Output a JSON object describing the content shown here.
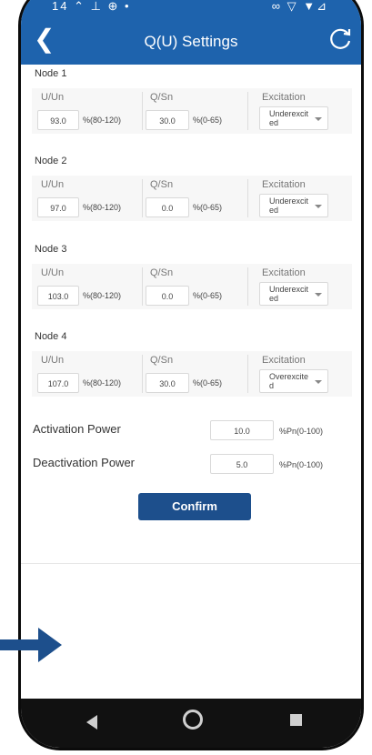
{
  "status_bar": {
    "left_icons": "14 ⌃ ⊥ ⊕ •",
    "right_icons": "∞ ▽ ▼⊿"
  },
  "header": {
    "title": "Q(U) Settings",
    "back_icon": "back-arrow-icon",
    "refresh_icon": "refresh-icon"
  },
  "nodes": [
    {
      "title": "Node 1",
      "u_label": "U/Un",
      "u_value": "93.0",
      "u_unit": "%(80-120)",
      "q_label": "Q/Sn",
      "q_value": "30.0",
      "q_unit": "%(0-65)",
      "ex_label": "Excitation",
      "ex_value": "Underexcited"
    },
    {
      "title": "Node 2",
      "u_label": "U/Un",
      "u_value": "97.0",
      "u_unit": "%(80-120)",
      "q_label": "Q/Sn",
      "q_value": "0.0",
      "q_unit": "%(0-65)",
      "ex_label": "Excitation",
      "ex_value": "Underexcited"
    },
    {
      "title": "Node 3",
      "u_label": "U/Un",
      "u_value": "103.0",
      "u_unit": "%(80-120)",
      "q_label": "Q/Sn",
      "q_value": "0.0",
      "q_unit": "%(0-65)",
      "ex_label": "Excitation",
      "ex_value": "Underexcited"
    },
    {
      "title": "Node 4",
      "u_label": "U/Un",
      "u_value": "107.0",
      "u_unit": "%(80-120)",
      "q_label": "Q/Sn",
      "q_value": "30.0",
      "q_unit": "%(0-65)",
      "ex_label": "Excitation",
      "ex_value": "Overexcited"
    }
  ],
  "activation": {
    "label": "Activation Power",
    "value": "10.0",
    "unit": "%Pn(0-100)"
  },
  "deactivation": {
    "label": "Deactivation Power",
    "value": "5.0",
    "unit": "%Pn(0-100)"
  },
  "confirm_label": "Confirm",
  "colors": {
    "header_bg": "#1e63ad",
    "confirm_bg": "#1d4f8c",
    "arrow": "#1d4f8c"
  }
}
